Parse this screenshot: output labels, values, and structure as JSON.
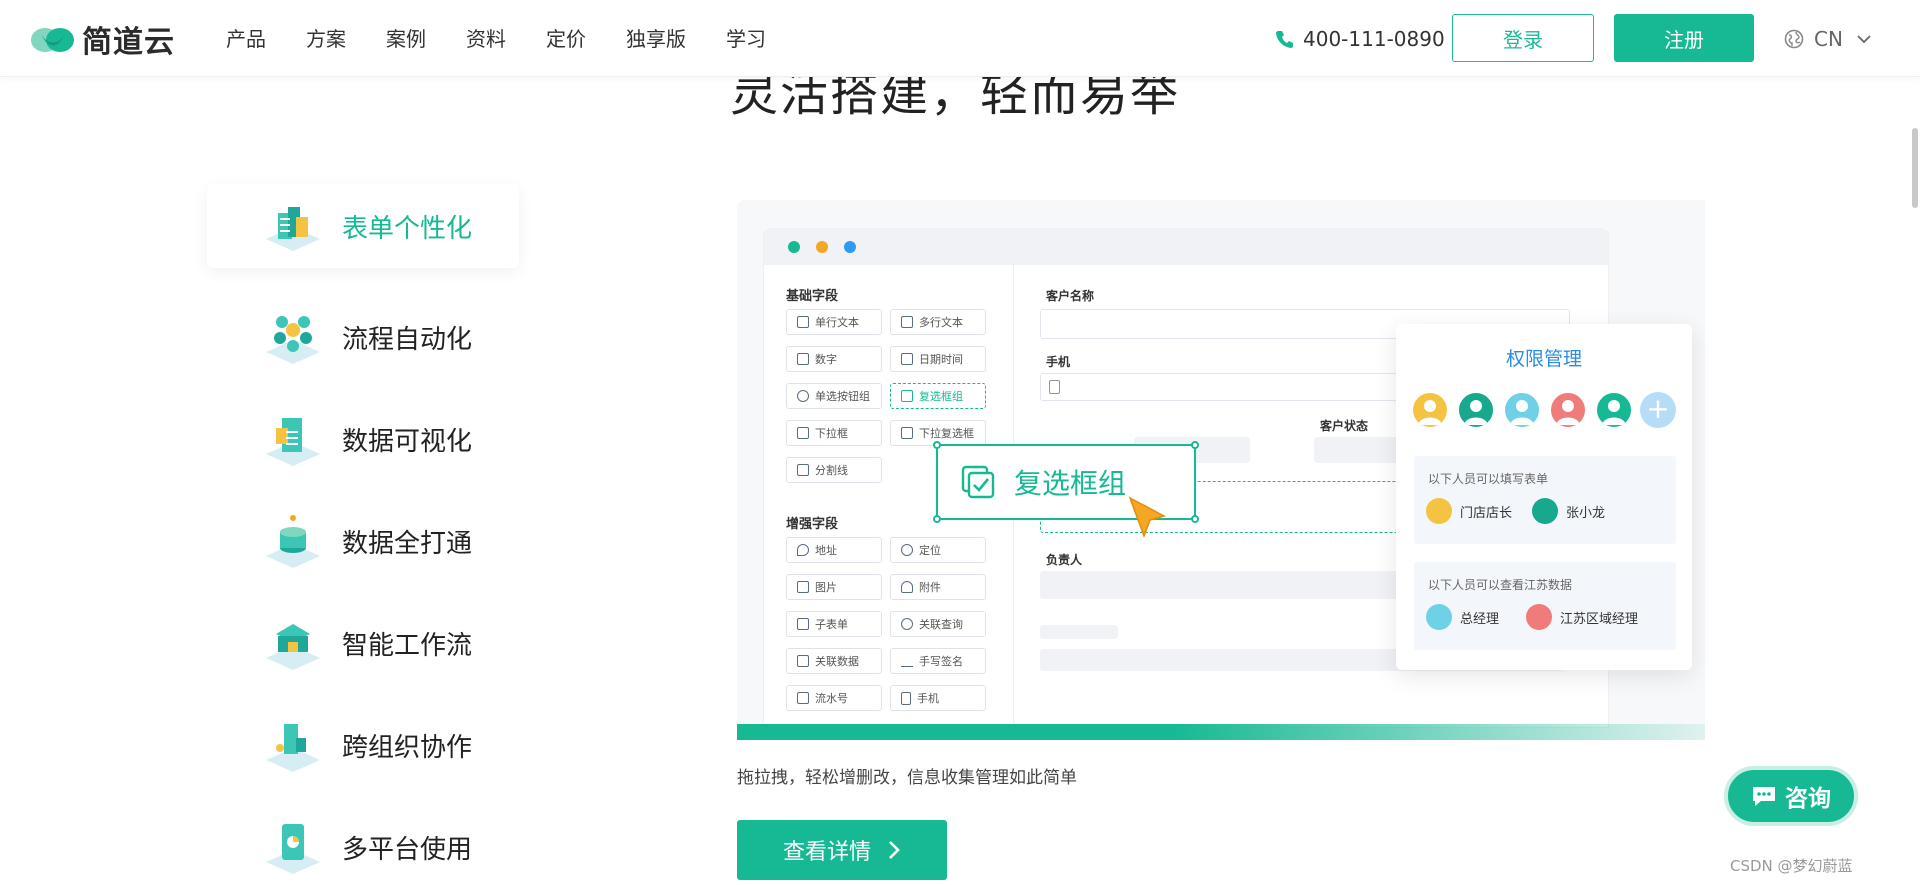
{
  "header": {
    "brand": "简道云",
    "nav": [
      "产品",
      "方案",
      "案例",
      "资料",
      "定价",
      "独享版",
      "学习"
    ],
    "phone": "400-111-0890",
    "login_label": "登录",
    "register_label": "注册",
    "lang_label": "CN"
  },
  "headline": "灵活搭建，轻而易举",
  "side_menu": [
    {
      "label": "表单个性化",
      "active": true
    },
    {
      "label": "流程自动化",
      "active": false
    },
    {
      "label": "数据可视化",
      "active": false
    },
    {
      "label": "数据全打通",
      "active": false
    },
    {
      "label": "智能工作流",
      "active": false
    },
    {
      "label": "跨组织协作",
      "active": false
    },
    {
      "label": "多平台使用",
      "active": false
    }
  ],
  "preview": {
    "basic_title": "基础字段",
    "basic_fields": [
      "单行文本",
      "多行文本",
      "数字",
      "日期时间",
      "单选按钮组",
      "复选框组",
      "下拉框",
      "下拉复选框",
      "分割线"
    ],
    "enhanced_title": "增强字段",
    "enhanced_fields": [
      "地址",
      "定位",
      "图片",
      "附件",
      "子表单",
      "关联查询",
      "关联数据",
      "手写签名",
      "流水号",
      "手机"
    ],
    "form_labels": {
      "customer_name": "客户名称",
      "phone": "手机",
      "customer_status": "客户状态",
      "owner": "负责人"
    },
    "drag_label": "复选框组",
    "permission": {
      "title": "权限管理",
      "box1_title": "以下人员可以填写表单",
      "box1_users": [
        "门店店长",
        "张小龙"
      ],
      "box2_title": "以下人员可以查看江苏数据",
      "box2_users": [
        "总经理",
        "江苏区域经理"
      ],
      "plus": "+"
    }
  },
  "caption": "拖拉拽，轻松增删改，信息收集管理如此简单",
  "detail_label": "查看详情",
  "consult_label": "咨询",
  "watermark": "CSDN @梦幻蔚蓝",
  "colors": {
    "brand": "#17b994",
    "blue": "#2b8ce6",
    "dot_green": "#17b994",
    "dot_orange": "#f5a623",
    "dot_blue": "#2f9bf0"
  }
}
